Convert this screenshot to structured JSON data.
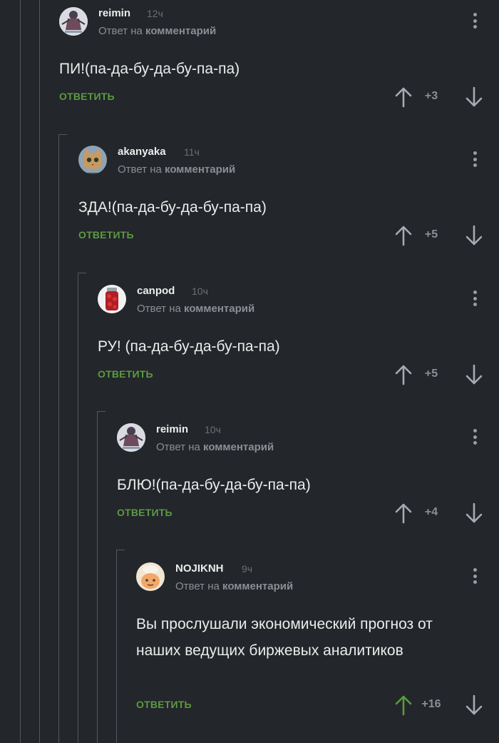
{
  "reply_to_prefix": "Ответ на",
  "reply_to_link": "комментарий",
  "reply_button_label": "ОТВЕТИТЬ",
  "colors": {
    "background": "#23262a",
    "reply_green": "#5b9a42",
    "upvote_active": "#5b9a42",
    "muted": "#8b8f95"
  },
  "comments": [
    {
      "username": "reimin",
      "time": "12ч",
      "text": "ПИ!(па-да-бу-да-бу-па-па)",
      "rating": "+3",
      "avatar": "anime-figure-avatar"
    },
    {
      "username": "akanyaka",
      "time": "11ч",
      "text": "ЗДА!(па-да-бу-да-бу-па-па)",
      "rating": "+5",
      "avatar": "cat-avatar"
    },
    {
      "username": "canpod",
      "time": "10ч",
      "text": "РУ! (па-да-бу-да-бу-па-па)",
      "rating": "+5",
      "avatar": "canned-tomatoes-avatar"
    },
    {
      "username": "reimin",
      "time": "10ч",
      "text": "БЛЮ!(па-да-бу-да-бу-па-па)",
      "rating": "+4",
      "avatar": "anime-figure-avatar"
    },
    {
      "username": "NOJIKNH",
      "time": "9ч",
      "text": "Вы прослушали экономический прогноз от наших ведущих биржевых аналитиков",
      "rating": "+16",
      "upvoted": true,
      "avatar": "cartoon-face-avatar"
    }
  ]
}
